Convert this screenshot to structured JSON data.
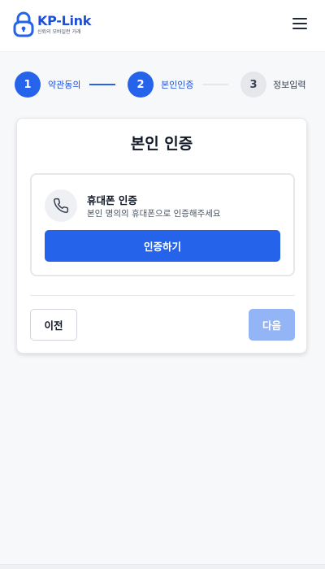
{
  "header": {
    "logo_title": "KP-Link",
    "logo_subtitle": "신뢰의 모바일런 거래",
    "logo_icon": "lock-icon",
    "menu_icon": "hamburger-menu-icon"
  },
  "stepper": {
    "steps": [
      {
        "number": "1",
        "label": "약관동의",
        "state": "completed"
      },
      {
        "number": "2",
        "label": "본인인증",
        "state": "current"
      },
      {
        "number": "3",
        "label": "정보입력",
        "state": "upcoming"
      }
    ]
  },
  "card": {
    "title": "본인 인증",
    "option": {
      "icon": "phone-icon",
      "title": "휴대폰 인증",
      "description": "본인 명의의 휴대폰으로 인증해주세요",
      "button_label": "인증하기"
    },
    "prev_label": "이전",
    "next_label": "다음"
  },
  "colors": {
    "primary": "#2563eb",
    "primary_disabled": "#93b4f5",
    "inactive_step": "#e5e7eb",
    "background": "#f7f8fa"
  }
}
